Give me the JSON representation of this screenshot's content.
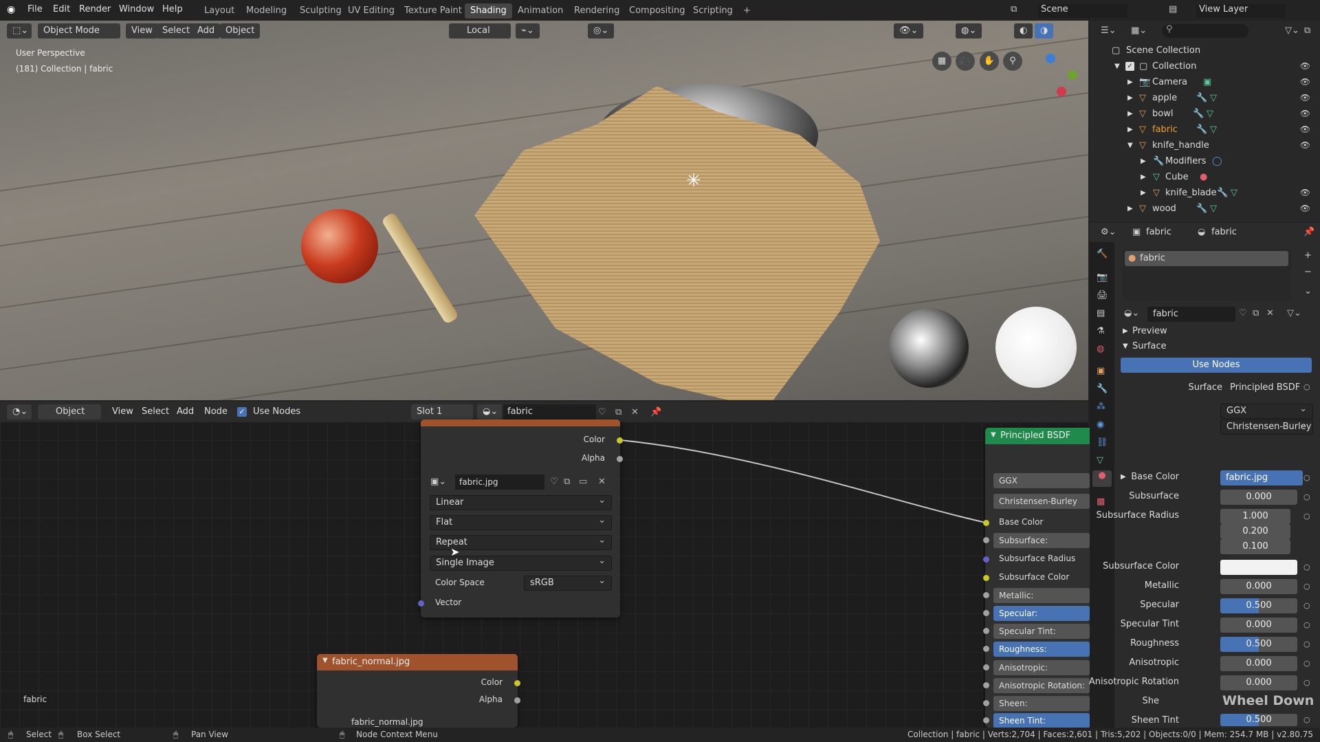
{
  "menu": [
    "File",
    "Edit",
    "Render",
    "Window",
    "Help"
  ],
  "workspaces": [
    "Layout",
    "Modeling",
    "Sculpting",
    "UV Editing",
    "Texture Paint",
    "Shading",
    "Animation",
    "Rendering",
    "Compositing",
    "Scripting"
  ],
  "active_workspace": "Shading",
  "scene": "Scene",
  "view_layer": "View Layer",
  "viewport": {
    "mode": "Object Mode",
    "menus": [
      "View",
      "Select",
      "Add",
      "Object"
    ],
    "transform": "Local",
    "perspective": "User Perspective",
    "collection_info": "(181) Collection | fabric"
  },
  "node_editor": {
    "mode": "Object",
    "menus": [
      "View",
      "Select",
      "Add",
      "Node"
    ],
    "use_nodes": "Use Nodes",
    "slot": "Slot 1",
    "material": "fabric",
    "overlay_label": "fabric",
    "image_node": {
      "title": "fabric.jpg",
      "outputs": [
        "Color",
        "Alpha"
      ],
      "image": "fabric.jpg",
      "interpolation": "Linear",
      "projection": "Flat",
      "extension": "Repeat",
      "source": "Single Image",
      "color_space_label": "Color Space",
      "color_space": "sRGB",
      "input": "Vector"
    },
    "normal_node": {
      "title": "fabric_normal.jpg",
      "outputs": [
        "Color",
        "Alpha"
      ],
      "image": "fabric_normal.jpg"
    },
    "bsdf_node": {
      "title": "Principled BSDF",
      "distribution": "GGX",
      "subsurface_method": "Christensen-Burley",
      "inputs": [
        "Base Color",
        "Subsurface:",
        "Subsurface Radius",
        "Subsurface Color",
        "Metallic:",
        "Specular:",
        "Specular Tint:",
        "Roughness:",
        "Anisotropic:",
        "Anisotropic Rotation:",
        "Sheen:",
        "Sheen Tint:"
      ]
    }
  },
  "outliner": {
    "root": "Scene Collection",
    "collection": "Collection",
    "items": [
      "Camera",
      "apple",
      "bowl",
      "fabric",
      "knife_handle",
      "Modifiers",
      "Cube",
      "knife_blade",
      "wood"
    ]
  },
  "properties": {
    "object": "fabric",
    "material": "fabric",
    "slot_item": "fabric",
    "material_field": "fabric",
    "preview": "Preview",
    "surface_panel": "Surface",
    "use_nodes": "Use Nodes",
    "surface_label": "Surface",
    "surface_value": "Principled BSDF",
    "distribution": "GGX",
    "subsurface_method": "Christensen-Burley",
    "rows": [
      {
        "label": "Base Color",
        "value": "fabric.jpg"
      },
      {
        "label": "Subsurface",
        "value": "0.000"
      },
      {
        "label": "Subsurface Radius",
        "value": "1.000"
      },
      {
        "label": "",
        "value": "0.200"
      },
      {
        "label": "",
        "value": "0.100"
      },
      {
        "label": "Subsurface Color",
        "value": ""
      },
      {
        "label": "Metallic",
        "value": "0.000"
      },
      {
        "label": "Specular",
        "value": "0.500"
      },
      {
        "label": "Specular Tint",
        "value": "0.000"
      },
      {
        "label": "Roughness",
        "value": "0.500"
      },
      {
        "label": "Anisotropic",
        "value": "0.000"
      },
      {
        "label": "Anisotropic Rotation",
        "value": "0.000"
      },
      {
        "label": "Sheen",
        "value": ""
      },
      {
        "label": "Sheen Tint",
        "value": "0.500"
      }
    ],
    "overlay_text": "Wheel Down"
  },
  "status": {
    "select": "Select",
    "box_select": "Box Select",
    "pan_view": "Pan View",
    "context_menu": "Node Context Menu",
    "stats": "Collection | fabric | Verts:2,704 | Faces:2,601 | Tris:5,202 | Objects:0/0 | Mem: 254.7 MB | v2.80.75"
  },
  "colors": {
    "accent": "#4772b3",
    "selected": "#f0a030",
    "image_node_header": "#a0522d",
    "bsdf_header": "#1f8a4c"
  }
}
